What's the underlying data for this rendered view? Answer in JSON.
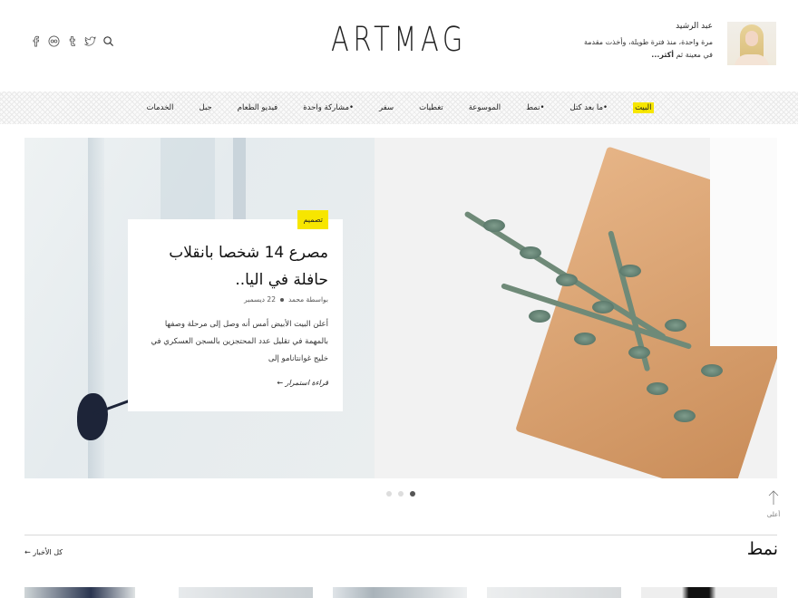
{
  "header": {
    "logo": "ARTMAG",
    "social_icons": [
      "search-icon",
      "twitter-icon",
      "tumblr-icon",
      "flickr-icon",
      "facebook-icon"
    ],
    "author": {
      "name": "عبد الرشيد",
      "bio": "مرة واحدة، منذ فترة طويلة، وأخذت مقدمة في معينة ثم",
      "more": "أكثر..."
    }
  },
  "nav": {
    "items": [
      {
        "label": "البيت",
        "active": true
      },
      {
        "label": "•ما بعد كتل",
        "active": false
      },
      {
        "label": "•نمط",
        "active": false
      },
      {
        "label": "الموسوعة",
        "active": false
      },
      {
        "label": "تغطيات",
        "active": false
      },
      {
        "label": "سفر",
        "active": false
      },
      {
        "label": "•مشاركة واحدة",
        "active": false
      },
      {
        "label": "فيديو الطعام",
        "active": false
      },
      {
        "label": "جبل",
        "active": false
      },
      {
        "label": "الخدمات",
        "active": false
      }
    ]
  },
  "hero": {
    "tag": "تصميم",
    "title": "مصرع 14 شخصا بانقلاب حافلة في اليا..",
    "meta_author": "بواسطة محمد",
    "meta_date": "22 ديسمبر",
    "excerpt": "أعلن البيت الأبيض أمس أنه وصل إلى مرحلة وصفها بالمهمة في تقليل عدد المحتجزين بالسجن العسكري في خليج غوانتانامو إلى",
    "read_more": "قراءة استمرار ←"
  },
  "slider": {
    "count": 3,
    "active_index": 0
  },
  "to_top_label": "أعلى",
  "section": {
    "title": "نمط",
    "all_news": "كل الأخبار ←"
  },
  "colors": {
    "accent": "#f7e600",
    "text": "#222222"
  }
}
